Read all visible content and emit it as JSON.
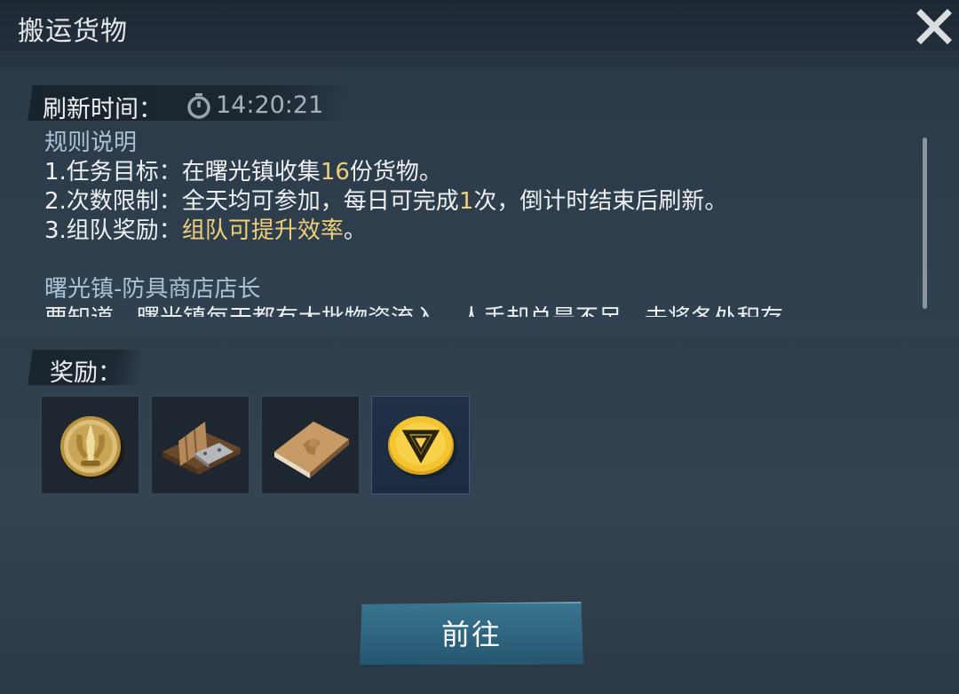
{
  "header": {
    "title": "搬运货物"
  },
  "refresh": {
    "label": "刷新时间：",
    "time": "14:20:21"
  },
  "description": {
    "rules_heading": "规则说明",
    "rule1_prefix": "1.任务目标：在曙光镇收集",
    "rule1_count": "16",
    "rule1_suffix": "份货物。",
    "rule2_prefix": "2.次数限制：全天均可参加，每日可完成",
    "rule2_count": "1",
    "rule2_suffix": "次，倒计时结束后刷新。",
    "rule3_prefix": "3.组队奖励：",
    "rule3_highlight": "组队可提升效率",
    "rule3_suffix": "。",
    "npc_heading": "曙光镇-防具商店店长",
    "npc_text": "要知道，曙光镇每天都有大批物资流入，人手却总是不足，去将各处积存"
  },
  "rewards": {
    "label": "奖励：",
    "items": [
      {
        "icon": "gold-medal-icon"
      },
      {
        "icon": "wood-plank-material-icon"
      },
      {
        "icon": "book-icon"
      },
      {
        "icon": "gold-coin-icon"
      }
    ]
  },
  "actions": {
    "go_label": "前往"
  },
  "colors": {
    "highlight": "#f0cf7a",
    "heading_blue": "#a9c2d6",
    "button": "#2f6580"
  }
}
